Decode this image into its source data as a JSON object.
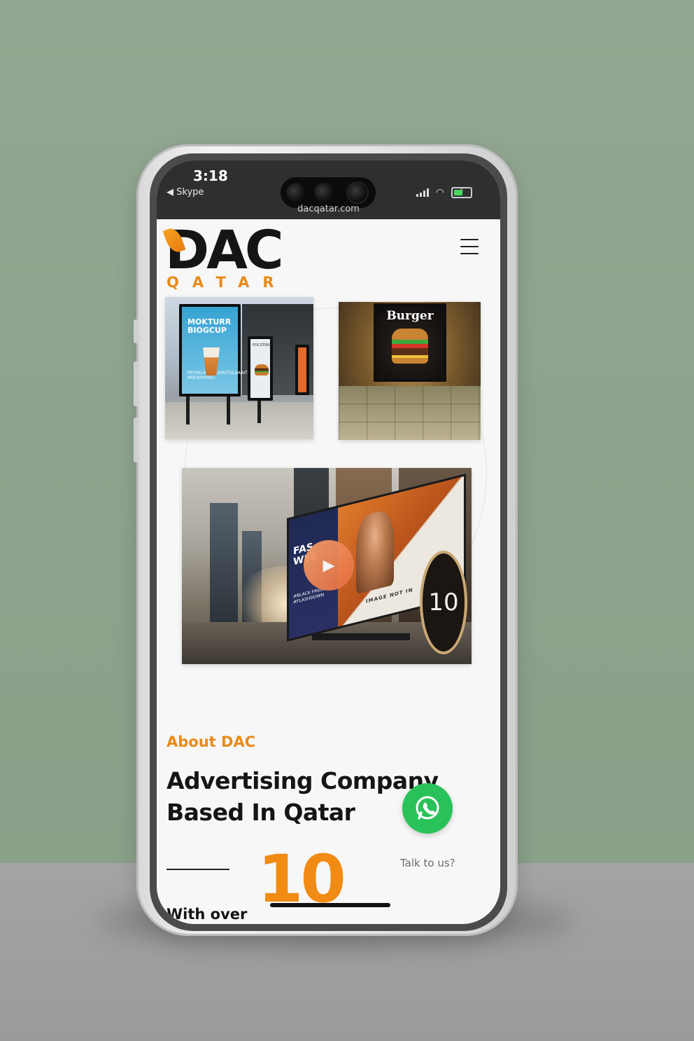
{
  "status_bar": {
    "time": "3:18",
    "back_app": "Skype",
    "url": "dacqatar.com"
  },
  "header": {
    "logo_main": "DAC",
    "logo_sub": "QATAR"
  },
  "images": {
    "image1": {
      "board_text": "MOKTURR BIOGCUP",
      "board_small": "PEYVELMORKDORITOLDAAITE MOCKPIORG!",
      "board2_text": "POCOTING"
    },
    "image2": {
      "title": "Burger"
    },
    "video": {
      "billboard_text": "FAS WEE",
      "billboard_small": "#BLACK FRIDAY #FLASHDOWN",
      "caption": "IMAGE NOT IN",
      "circle_number": "10"
    }
  },
  "about": {
    "label": "About DAC",
    "headline_line1": "Advertising Company",
    "headline_line2": "Based In Qatar",
    "big_number": "10",
    "with_over": "With over"
  },
  "whatsapp": {
    "label": "Talk to us?"
  },
  "colors": {
    "brand_orange": "#e88a19",
    "whatsapp_green": "#29c25a",
    "play_orange": "#e56c3e"
  }
}
